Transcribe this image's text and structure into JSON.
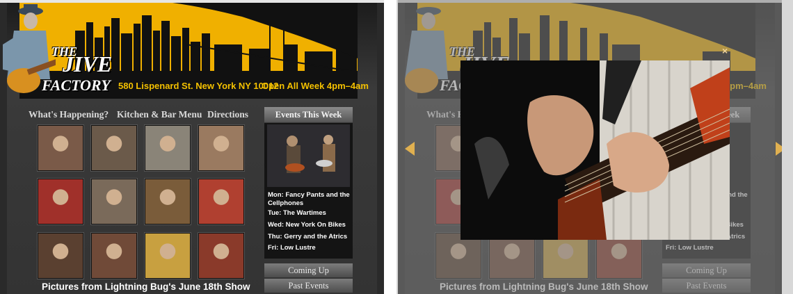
{
  "site": {
    "logo_line1": "THE",
    "logo_line2": "JIVE",
    "logo_line3": "FACTORY",
    "address": "580 Lispenard St. New York NY 10012",
    "hours": "Open All Week 4pm–4am"
  },
  "nav": [
    "What's Happening?",
    "Kitchen & Bar Menu",
    "Directions"
  ],
  "events": {
    "header": "Events This Week",
    "items": [
      "Mon: Fancy Pants and the Cellphones",
      "Tue: The Wartimes",
      "Wed: New York On Bikes",
      "Thu: Gerry and the Atrics",
      "Fri: Low Lustre"
    ],
    "coming_up": "Coming Up",
    "past_events": "Past Events"
  },
  "gallery": {
    "caption": "Pictures from Lightning Bug's June 18th Show",
    "thumb_colors": [
      "#7a5a48",
      "#6b5a4a",
      "#8a8478",
      "#9a7a60",
      "#a0302a",
      "#7a6a5a",
      "#7a5c3a",
      "#b04030",
      "#5a4030",
      "#704a38",
      "#c8a040",
      "#8a3a2a"
    ]
  },
  "lightbox": {
    "close_symbol": "×",
    "prev_icon": "triangle-left",
    "next_icon": "triangle-right"
  },
  "colors": {
    "accent_yellow": "#f0b000",
    "text_yellow": "#f3c000"
  }
}
